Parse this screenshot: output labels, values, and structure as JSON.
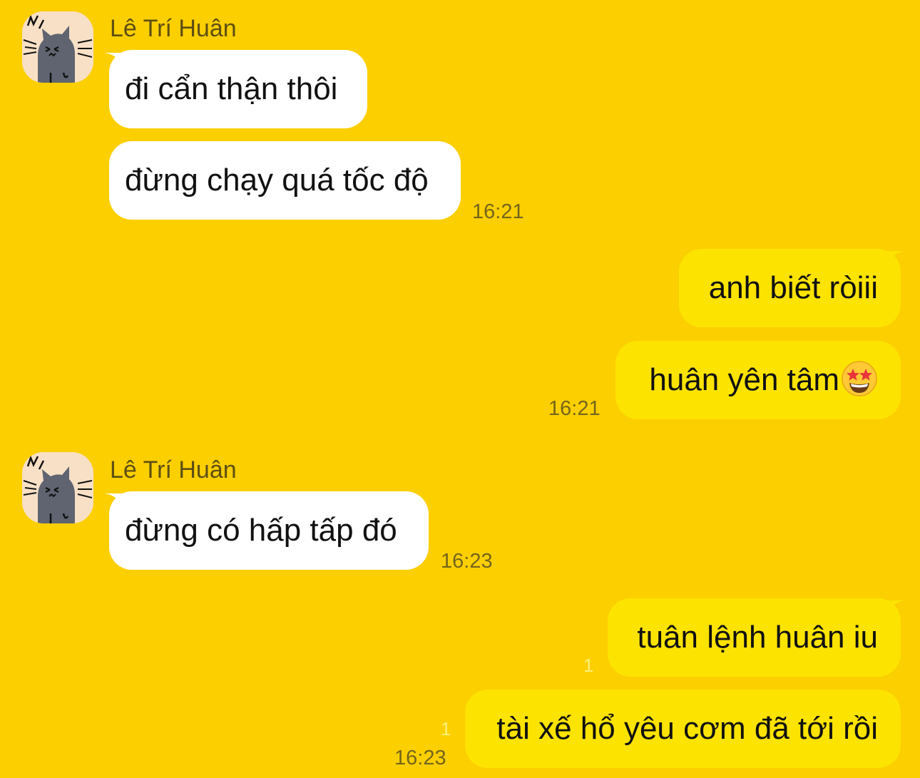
{
  "colors": {
    "background": "#FCCF00",
    "incoming_bubble": "#FFFFFF",
    "outgoing_bubble": "#FDE300",
    "timestamp": "#75651A",
    "unread_count": "#FDF07A"
  },
  "groups": [
    {
      "sender": "Lê Trí Huân",
      "avatar_icon": "cat-avatar-icon",
      "messages": [
        "đi cẩn thận thôi",
        "đừng chạy quá tốc độ"
      ],
      "time": "16:21"
    },
    {
      "sender": "me",
      "messages": [
        "anh biết ròiii",
        "huân yên tâm"
      ],
      "emoji": "star-struck-emoji-icon",
      "time": "16:21"
    },
    {
      "sender": "Lê Trí Huân",
      "avatar_icon": "cat-avatar-icon",
      "messages": [
        "đừng có hấp tấp đó"
      ],
      "time": "16:23"
    },
    {
      "sender": "me",
      "messages": [
        "tuân lệnh huân iu",
        "tài xế hổ yêu cơm đã tới rồi"
      ],
      "unread_counts": [
        "1",
        "1"
      ],
      "time": "16:23"
    }
  ]
}
